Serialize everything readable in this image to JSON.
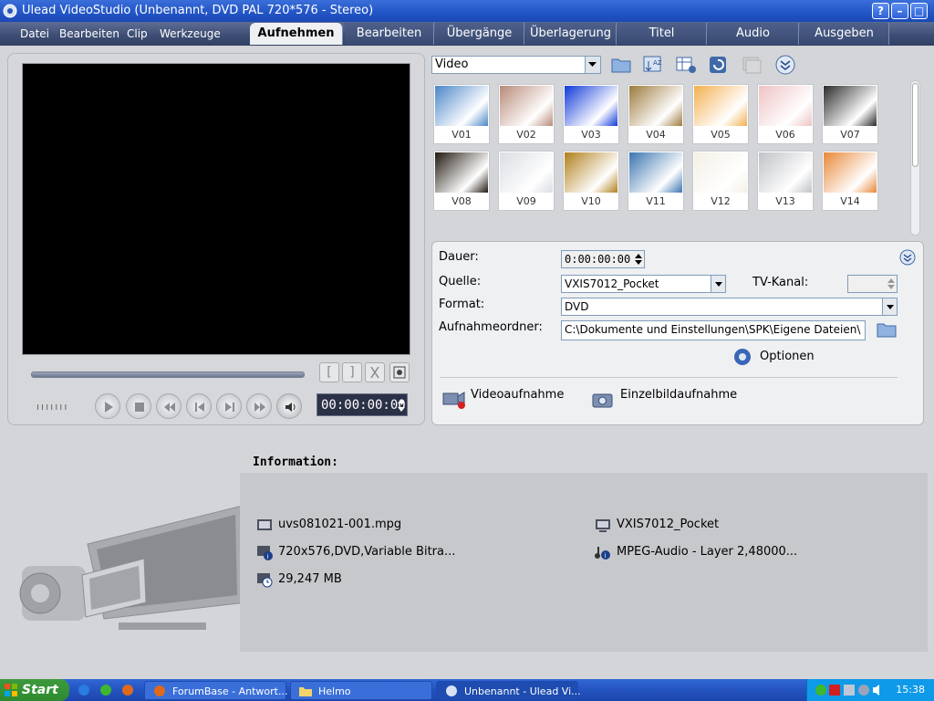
{
  "window": {
    "title": "Ulead VideoStudio (Unbenannt, DVD PAL 720*576 - Stereo)",
    "controls": [
      "?",
      "–",
      "□",
      "×"
    ]
  },
  "menu": [
    "Datei",
    "Bearbeiten",
    "Clip",
    "Werkzeuge"
  ],
  "tabs": [
    "Aufnehmen",
    "Bearbeiten",
    "Übergänge",
    "Überlagerung",
    "Titel",
    "Audio",
    "Ausgeben"
  ],
  "active_tab": "Aufnehmen",
  "preview": {
    "timecode": "00:00:00:00",
    "trim_buttons": [
      "[",
      "]"
    ]
  },
  "library": {
    "category": "Video",
    "thumbnails": [
      {
        "label": "V01",
        "color": "#4a86c8"
      },
      {
        "label": "V02",
        "color": "#b88a78"
      },
      {
        "label": "V03",
        "color": "#1038d8"
      },
      {
        "label": "V04",
        "color": "#9c7a3c"
      },
      {
        "label": "V05",
        "color": "#f2b050"
      },
      {
        "label": "V06",
        "color": "#efc2c4"
      },
      {
        "label": "V07",
        "color": "#2a2a2a"
      },
      {
        "label": "V08",
        "color": "#201810"
      },
      {
        "label": "V09",
        "color": "#dadde2"
      },
      {
        "label": "V10",
        "color": "#b0801c"
      },
      {
        "label": "V11",
        "color": "#3a74b0"
      },
      {
        "label": "V12",
        "color": "#f4f0e6"
      },
      {
        "label": "V13",
        "color": "#c0c2c6"
      },
      {
        "label": "V14",
        "color": "#e88838"
      }
    ]
  },
  "capture": {
    "duration_label": "Dauer:",
    "duration_value": "0:00:00:00",
    "source_label": "Quelle:",
    "source_value": "VXIS7012_Pocket",
    "tv_channel_label": "TV-Kanal:",
    "format_label": "Format:",
    "format_value": "DVD",
    "folder_label": "Aufnahmeordner:",
    "folder_value": "C:\\Dokumente und Einstellungen\\SPK\\Eigene Dateien\\",
    "options_label": "Optionen",
    "video_capture_label": "Videoaufnahme",
    "snapshot_label": "Einzelbildaufnahme"
  },
  "info": {
    "title": "Information:",
    "file": "uvs081021-001.mpg",
    "video": "720x576,DVD,Variable Bitra...",
    "size": "29,247 MB",
    "device": "VXIS7012_Pocket",
    "audio": "MPEG-Audio - Layer 2,48000..."
  },
  "taskbar": {
    "start": "Start",
    "tasks": [
      "ForumBase - Antwort...",
      "Helmo",
      "Unbenannt - Ulead Vi..."
    ],
    "clock": "15:38"
  }
}
